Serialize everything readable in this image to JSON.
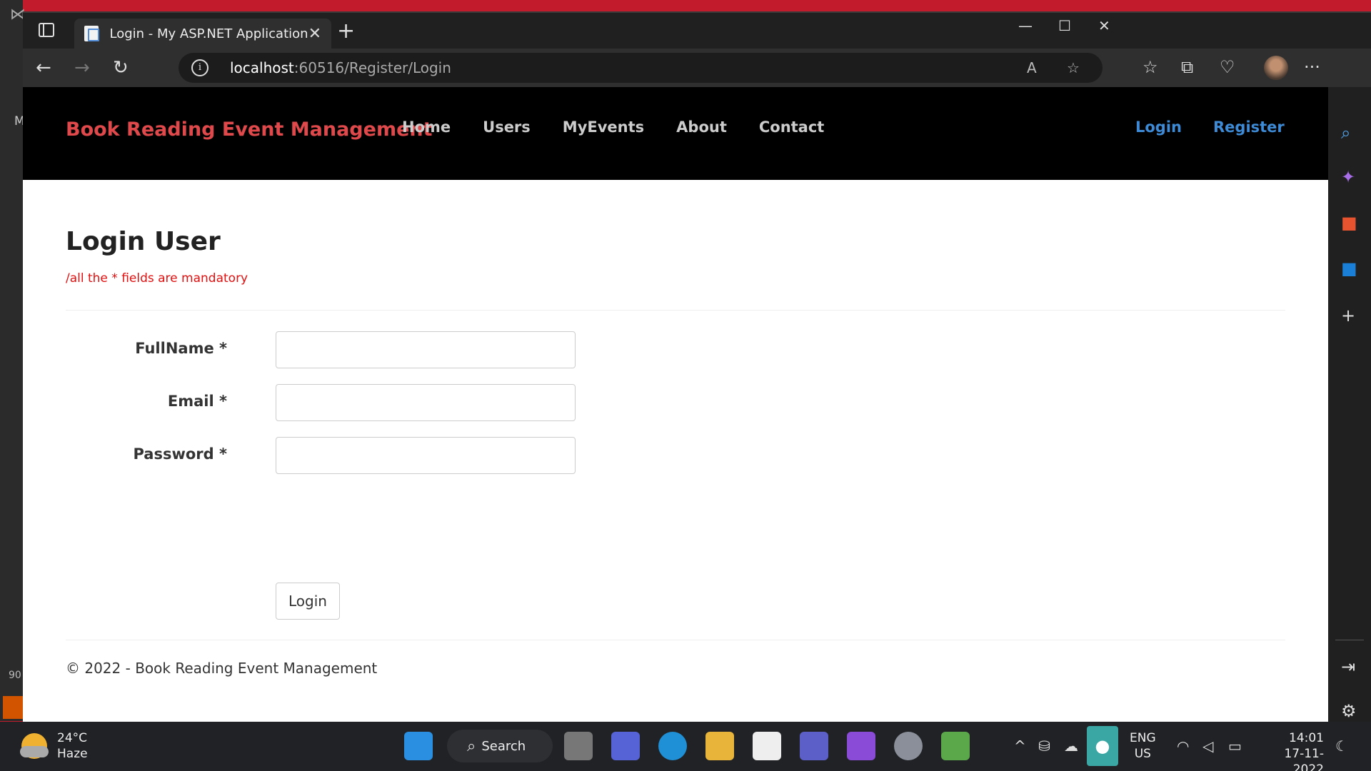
{
  "background": {
    "m_text": "M",
    "n_text": "90"
  },
  "browser": {
    "tab_title": "Login - My ASP.NET Application",
    "tab_close": "✕",
    "new_tab": "+",
    "url_host": "localhost",
    "url_rest": ":60516/Register/Login",
    "info": "i",
    "more": "···"
  },
  "site": {
    "brand": "Book Reading Event Management",
    "nav": [
      "Home",
      "Users",
      "MyEvents",
      "About",
      "Contact"
    ],
    "auth": [
      "Login",
      "Register"
    ],
    "brand_color": "#e0494b",
    "link_color": "#3d8bd6"
  },
  "page": {
    "title": "Login User",
    "mandatory_note": "/all the * fields are mandatory",
    "fields": [
      {
        "label": "FullName  *",
        "value": "",
        "placeholder": ""
      },
      {
        "label": "Email  *",
        "value": "",
        "placeholder": ""
      },
      {
        "label": "Password  *",
        "value": "",
        "placeholder": ""
      }
    ],
    "submit_label": "Login",
    "footer": "© 2022 - Book Reading Event Management"
  },
  "taskbar": {
    "temp": "24°C",
    "weather": "Haze",
    "search_label": "Search",
    "lang_1": "ENG",
    "lang_2": "US",
    "time": "14:01",
    "date": "17-11-2022"
  }
}
